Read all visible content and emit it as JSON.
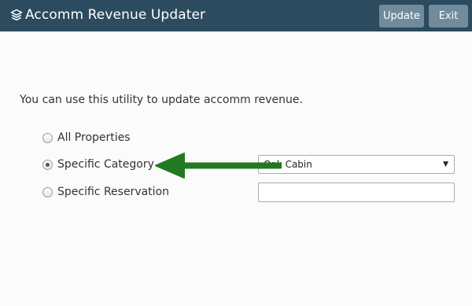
{
  "app": {
    "title": "Accomm Revenue Updater",
    "title_icon": "layers-icon"
  },
  "toolbar": {
    "update_label": "Update",
    "exit_label": "Exit"
  },
  "main": {
    "intro": "You can use this utility to update accomm revenue.",
    "options": [
      {
        "label": "All Properties",
        "checked": false
      },
      {
        "label": "Specific Category",
        "checked": true
      },
      {
        "label": "Specific Reservation",
        "checked": false
      }
    ],
    "category_select": {
      "value": "Oak Cabin"
    },
    "reservation_input": {
      "value": "",
      "placeholder": ""
    }
  },
  "annotation": {
    "arrow_color": "#217a21"
  },
  "colors": {
    "titlebar": "#2c4b5f",
    "button": "#6f8b9c",
    "background": "#fbfbfb"
  }
}
